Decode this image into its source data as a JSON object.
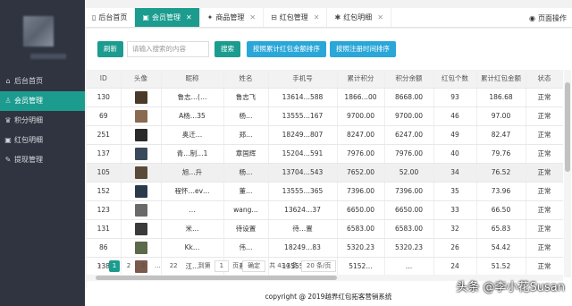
{
  "sidebar": {
    "items": [
      {
        "label": "后台首页",
        "icon": "home-icon",
        "glyph": "⌂"
      },
      {
        "label": "会员管理",
        "icon": "user-icon",
        "glyph": "♙"
      },
      {
        "label": "积分明细",
        "icon": "points-icon",
        "glyph": "♛"
      },
      {
        "label": "红包明细",
        "icon": "redpacket-icon",
        "glyph": "▣"
      },
      {
        "label": "提现管理",
        "icon": "withdraw-icon",
        "glyph": "✎"
      }
    ]
  },
  "tabs": [
    {
      "label": "后台首页",
      "glyph": "▯"
    },
    {
      "label": "会员管理",
      "glyph": "▣",
      "active": true
    },
    {
      "label": "商品管理",
      "glyph": "✦"
    },
    {
      "label": "红包管理",
      "glyph": "⊟"
    },
    {
      "label": "红包明细",
      "glyph": "✱"
    }
  ],
  "page_ops": {
    "label": "页面操作",
    "glyph": "◉"
  },
  "toolbar": {
    "refresh_label": "刷新",
    "search_placeholder": "请输入搜索的内容",
    "search_label": "搜索",
    "sort_amount_label": "按照累计红包金额排序",
    "sort_time_label": "按照注册时间排序"
  },
  "table": {
    "headers": [
      "ID",
      "头像",
      "昵称",
      "姓名",
      "手机号",
      "累计积分",
      "积分余额",
      "红包个数",
      "累计红包金额",
      "状态"
    ],
    "rows": [
      [
        "130",
        "",
        "鲁志…(…",
        "鲁志飞",
        "13614…588",
        "1866…00",
        "8668.00",
        "93",
        "186.68",
        "正常"
      ],
      [
        "69",
        "",
        "A杨…35",
        "杨…",
        "13555…167",
        "9700.00",
        "9700.00",
        "46",
        "97.00",
        "正常"
      ],
      [
        "251",
        "",
        "奥迁…",
        "郑…",
        "18249…807",
        "8247.00",
        "6247.00",
        "49",
        "82.47",
        "正常"
      ],
      [
        "137",
        "",
        "青…制…1",
        "章国辉",
        "15204…591",
        "7976.00",
        "7976.00",
        "40",
        "79.76",
        "正常"
      ],
      [
        "105",
        "",
        "旭…升",
        "杨…",
        "13704…543",
        "7652.00",
        "52.00",
        "34",
        "76.52",
        "正常"
      ],
      [
        "152",
        "",
        "程怀…ev…",
        "董…",
        "13555…365",
        "7396.00",
        "7396.00",
        "35",
        "73.96",
        "正常"
      ],
      [
        "123",
        "",
        "…",
        "wang…",
        "13624…37",
        "6650.00",
        "6650.00",
        "33",
        "66.50",
        "正常"
      ],
      [
        "131",
        "",
        "米…",
        "待设置",
        "待…置",
        "6583.00",
        "6583.00",
        "32",
        "65.83",
        "正常"
      ],
      [
        "86",
        "",
        "Kk…",
        "伟…",
        "18249…83",
        "5320.23",
        "5320.23",
        "26",
        "54.42",
        "正常"
      ],
      [
        "138",
        "",
        "江…",
        "蔡…",
        "13555…165",
        "5152…",
        "…",
        "24",
        "51.52",
        "正常"
      ]
    ]
  },
  "pager": {
    "prev": "‹",
    "pages": [
      "1",
      "2",
      "3",
      "...",
      "22"
    ],
    "next": "›",
    "goto_label": "到第",
    "goto_value": "1",
    "page_unit": "页",
    "confirm_label": "确定",
    "total": "共 434 条",
    "per_page": "20 条/页"
  },
  "footer": {
    "copyright": "copyright @ 2019越界红包拓客营销系统"
  },
  "watermark": "头条 @李小花Susan",
  "colors": {
    "sidebar_bg": "#2f3440",
    "accent": "#1b9c8f",
    "blue": "#2aa7d8"
  }
}
